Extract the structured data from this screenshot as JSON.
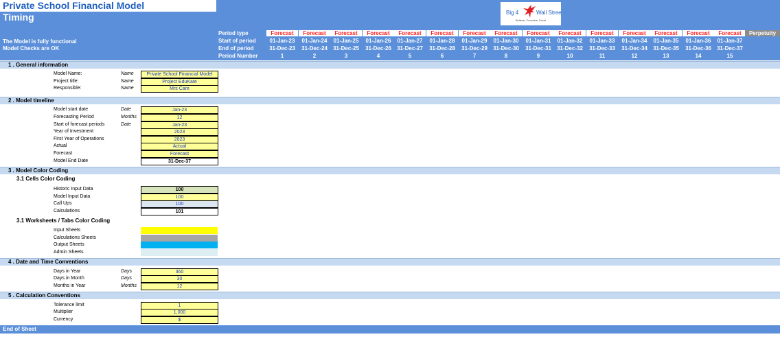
{
  "header": {
    "title": "Private School Financial Model",
    "subtitle": "Timing",
    "status_lines": [
      "The Model is fully functional",
      "Model Checks are OK"
    ],
    "logo": {
      "left": "Big 4",
      "right": "Wall Street",
      "tagline": "Believe, Conceive, Excel",
      "icon": "eagle-icon"
    }
  },
  "periods": {
    "row_labels": [
      "Period type",
      "Start of period",
      "End of period",
      "Period Number"
    ],
    "types": [
      "Forecast",
      "Forecast",
      "Forecast",
      "Forecast",
      "Forecast",
      "Forecast",
      "Forecast",
      "Forecast",
      "Forecast",
      "Forecast",
      "Forecast",
      "Forecast",
      "Forecast",
      "Forecast",
      "Forecast"
    ],
    "starts": [
      "01-Jan-23",
      "01-Jan-24",
      "01-Jan-25",
      "01-Jan-26",
      "01-Jan-27",
      "01-Jan-28",
      "01-Jan-29",
      "01-Jan-30",
      "01-Jan-31",
      "01-Jan-32",
      "01-Jan-33",
      "01-Jan-34",
      "01-Jan-35",
      "01-Jan-36",
      "01-Jan-37"
    ],
    "ends": [
      "31-Dec-23",
      "31-Dec-24",
      "31-Dec-25",
      "31-Dec-26",
      "31-Dec-27",
      "31-Dec-28",
      "31-Dec-29",
      "31-Dec-30",
      "31-Dec-31",
      "31-Dec-32",
      "31-Dec-33",
      "31-Dec-34",
      "31-Dec-35",
      "31-Dec-36",
      "31-Dec-37"
    ],
    "numbers": [
      "1",
      "2",
      "3",
      "4",
      "5",
      "6",
      "7",
      "8",
      "9",
      "10",
      "11",
      "12",
      "13",
      "14",
      "15"
    ],
    "perpetuity": "Perpetuity"
  },
  "sections": {
    "general": {
      "title": "1 . General information",
      "rows": [
        {
          "label": "Model Name:",
          "unit": "Name",
          "value": "Private School Financial Model"
        },
        {
          "label": "Project title:",
          "unit": "Name",
          "value": "Project EduKate"
        },
        {
          "label": "Responsible:",
          "unit": "Name",
          "value": "Mrs Care"
        }
      ]
    },
    "timeline": {
      "title": "2 . Model timeline",
      "rows": [
        {
          "label": "Model start date",
          "unit": "Date",
          "value": "Jan-23"
        },
        {
          "label": "Forecasting Period",
          "unit": "Months",
          "value": "12"
        },
        {
          "label": "Start of forecast periods",
          "unit": "Date",
          "value": "Jan-23"
        },
        {
          "label": "Year of Investment",
          "unit": "",
          "value": "2023"
        },
        {
          "label": "First Year of Operations",
          "unit": "",
          "value": "2023"
        },
        {
          "label": "Actual",
          "unit": "",
          "value": "Actual"
        },
        {
          "label": "Forecast",
          "unit": "",
          "value": "Forecast"
        },
        {
          "label": "Model End Date",
          "unit": "",
          "value": "31-Dec-37"
        }
      ]
    },
    "color_coding": {
      "title": "3 . Model Color Coding",
      "cells_title": "3.1 Cells Color Coding",
      "cells": [
        {
          "label": "Historic Input Data",
          "value": "100"
        },
        {
          "label": "Model Input Data",
          "value": "100"
        },
        {
          "label": "Call Ups",
          "value": "100"
        },
        {
          "label": "Calculations",
          "value": "101"
        }
      ],
      "tabs_title": "3.1 Worksheets / Tabs Color Coding",
      "tabs": [
        {
          "label": "Input Sheets",
          "color": "#ffff00"
        },
        {
          "label": "Calculations Sheets",
          "color": "#a6a6a6"
        },
        {
          "label": "Output Sheets",
          "color": "#00b0f0"
        },
        {
          "label": "Admin Sheets",
          "color": "#ddeef3"
        }
      ]
    },
    "date_time": {
      "title": "4 . Date and Time Conventions",
      "rows": [
        {
          "label": "Days in Year",
          "unit": "Days",
          "value": "360"
        },
        {
          "label": "Days in Month",
          "unit": "Days",
          "value": "30"
        },
        {
          "label": "Months in Year",
          "unit": "Months",
          "value": "12"
        }
      ]
    },
    "calc": {
      "title": "5 . Calculation Conventions",
      "rows": [
        {
          "label": "Tolerance limit",
          "unit": "",
          "value": "1"
        },
        {
          "label": "Multiplier",
          "unit": "",
          "value": "1,000"
        },
        {
          "label": "Currency",
          "unit": "",
          "value": "$"
        }
      ]
    }
  },
  "footer": {
    "label": "End of Sheet"
  },
  "colors": {
    "banner": "#5b8fd9",
    "section": "#c5d9f1",
    "input": "#ffff99",
    "forecast": "#ff2020"
  }
}
